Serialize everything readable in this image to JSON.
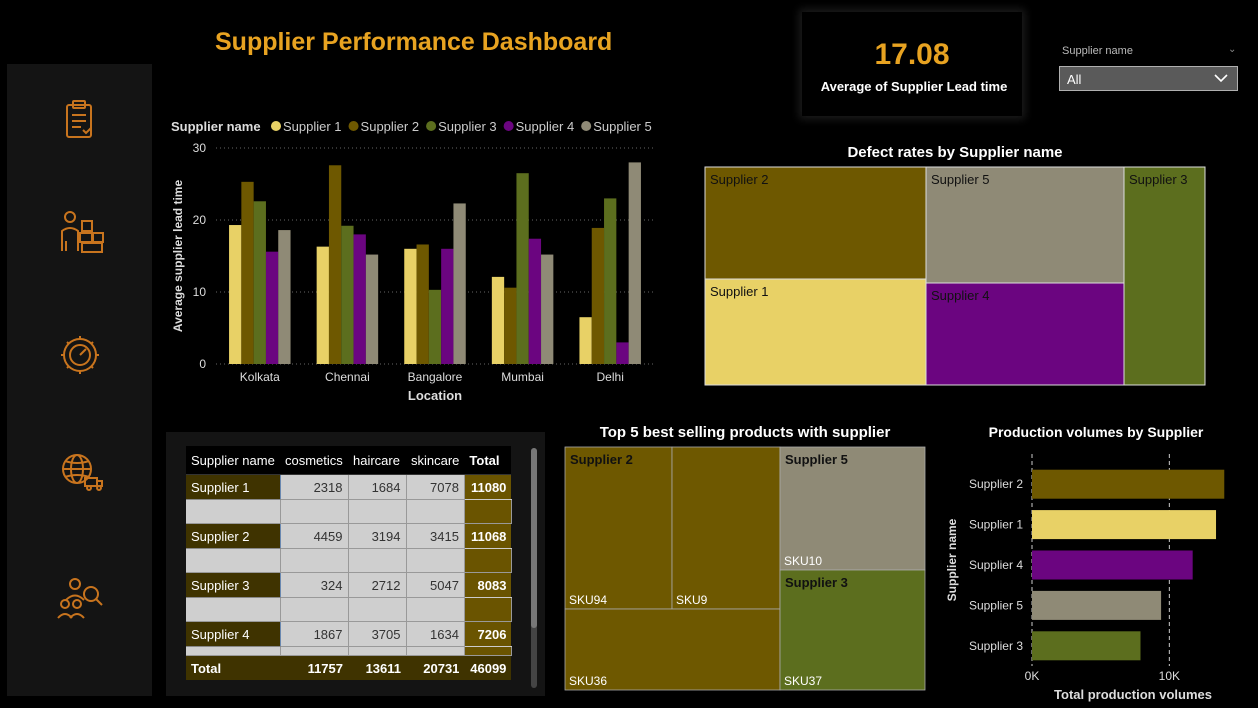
{
  "dashboard": {
    "title": "Supplier Performance Dashboard"
  },
  "sidebar": {
    "icons": [
      "clipboard-icon",
      "worker-boxes-icon",
      "gear-speed-icon",
      "globe-delivery-icon",
      "team-search-icon"
    ]
  },
  "kpi": {
    "value": "17.08",
    "label": "Average of Supplier Lead time"
  },
  "slicer": {
    "title": "Supplier name",
    "value": "All"
  },
  "colors": {
    "Supplier 1": "#E8D166",
    "Supplier 2": "#6E5800",
    "Supplier 3": "#5C6E1E",
    "Supplier 4": "#6B0580",
    "Supplier 5": "#8F8A76",
    "accent": "#E8A321"
  },
  "chart_data": [
    {
      "type": "bar",
      "legend_title": "Supplier name",
      "categories": [
        "Kolkata",
        "Chennai",
        "Bangalore",
        "Mumbai",
        "Delhi"
      ],
      "series": [
        {
          "name": "Supplier 1",
          "values": [
            19.3,
            16.3,
            16.0,
            12.1,
            6.5
          ]
        },
        {
          "name": "Supplier 2",
          "values": [
            25.3,
            27.6,
            16.6,
            10.6,
            18.9
          ]
        },
        {
          "name": "Supplier 3",
          "values": [
            22.6,
            19.2,
            10.3,
            26.5,
            23.0
          ]
        },
        {
          "name": "Supplier 4",
          "values": [
            15.6,
            18.0,
            16.0,
            17.4,
            3.0
          ]
        },
        {
          "name": "Supplier 5",
          "values": [
            18.6,
            15.2,
            22.3,
            15.2,
            28.0
          ]
        }
      ],
      "xlabel": "Location",
      "ylabel": "Average supplier lead time",
      "ylim": [
        0,
        30
      ],
      "yticks": [
        0,
        10,
        20,
        30
      ],
      "legend_position": "top-left",
      "grid": true
    },
    {
      "type": "treemap",
      "title": "Defect rates by Supplier name",
      "items": [
        {
          "name": "Supplier 2"
        },
        {
          "name": "Supplier 1"
        },
        {
          "name": "Supplier 5"
        },
        {
          "name": "Supplier 4"
        },
        {
          "name": "Supplier 3"
        }
      ]
    },
    {
      "type": "treemap",
      "title": "Top 5 best selling products with supplier",
      "groups": [
        {
          "name": "Supplier 2",
          "items": [
            "SKU94",
            "SKU9",
            "SKU36"
          ]
        },
        {
          "name": "Supplier 5",
          "items": [
            "SKU10"
          ]
        },
        {
          "name": "Supplier 3",
          "items": [
            "SKU37"
          ]
        }
      ]
    },
    {
      "type": "bar",
      "orientation": "horizontal",
      "title": "Production volumes by Supplier",
      "categories": [
        "Supplier 2",
        "Supplier 1",
        "Supplier 4",
        "Supplier 5",
        "Supplier 3"
      ],
      "values": [
        14000,
        13400,
        11700,
        9400,
        7900
      ],
      "xlabel": "Total production volumes",
      "ylabel": "Supplier name",
      "xlim": [
        0,
        15000
      ],
      "xticks": [
        "0K",
        "10K"
      ],
      "grid": true
    },
    {
      "type": "table",
      "columns": [
        "Supplier name",
        "cosmetics",
        "haircare",
        "skincare",
        "Total"
      ],
      "rows": [
        [
          "Supplier 1",
          "2318",
          "1684",
          "7078",
          "11080"
        ],
        [
          "Supplier 2",
          "4459",
          "3194",
          "3415",
          "11068"
        ],
        [
          "Supplier 3",
          "324",
          "2712",
          "5047",
          "8083"
        ],
        [
          "Supplier 4",
          "1867",
          "3705",
          "1634",
          "7206"
        ]
      ],
      "total": [
        "Total",
        "11757",
        "13611",
        "20731",
        "46099"
      ]
    }
  ]
}
